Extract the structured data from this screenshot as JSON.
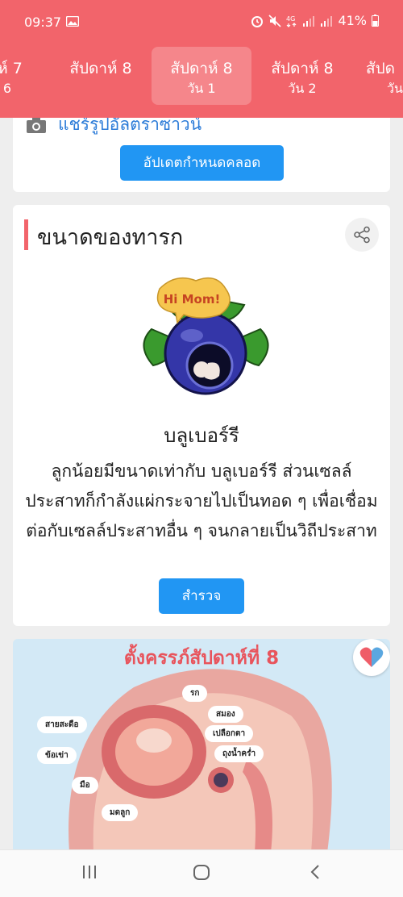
{
  "status_bar": {
    "time": "09:37",
    "battery": "41%",
    "icons": [
      "image-icon",
      "alarm-icon",
      "mute-icon",
      "4g-icon",
      "signal-icon",
      "signal-icon",
      "battery-icon"
    ]
  },
  "tabs": [
    {
      "week": "ดาห์ 7",
      "day": "น 6"
    },
    {
      "week": "สัปดาห์ 8",
      "day": ""
    },
    {
      "week": "สัปดาห์ 8",
      "day": "วัน 1",
      "active": true
    },
    {
      "week": "สัปดาห์ 8",
      "day": "วัน 2"
    },
    {
      "week": "สัปด",
      "day": "วัน"
    }
  ],
  "card1": {
    "link_text": "แชร์รูปอัลตราซาวน์",
    "button": "อัปเดตกำหนดคลอด"
  },
  "card2": {
    "title": "ขนาดของทารก",
    "speech_bubble": "Hi Mom!",
    "fruit_name": "บลูเบอร์รี",
    "description": "ลูกน้อยมีขนาดเท่ากับ บลูเบอร์รี ส่วนเซลล์ประสาทก็กำลังแผ่กระจายไปเป็นทอด ๆ เพื่อเชื่อมต่อกับเซลล์ประสาทอื่น ๆ จนกลายเป็นวิถีประสาท",
    "button": "สำรวจ"
  },
  "card3": {
    "title": "ตั้งครรภ์สัปดาห์ที่ 8",
    "labels": {
      "placenta": "รก",
      "brain": "สมอง",
      "eyelid": "เปลือกตา",
      "amniotic": "ถุงน้ำคร่ำ",
      "cord": "สายสะดือ",
      "knee": "ข้อเข่า",
      "hand": "มือ",
      "uterus": "มดลูก"
    }
  },
  "colors": {
    "brand": "#f2646b",
    "button": "#2196f3",
    "link": "#2b7bd8"
  }
}
